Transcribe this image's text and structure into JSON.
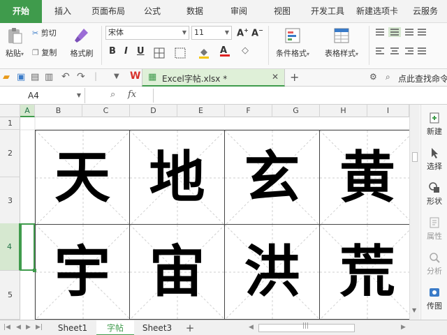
{
  "ribbon_tabs": [
    "开始",
    "插入",
    "页面布局",
    "公式",
    "数据",
    "审阅",
    "视图",
    "开发工具",
    "新建选项卡",
    "云服务"
  ],
  "active_ribbon_tab": "开始",
  "ribbon": {
    "paste_label": "粘贴",
    "cut_label": "剪切",
    "copy_label": "复制",
    "format_painter_label": "格式刷",
    "font_name": "宋体",
    "font_size": "11",
    "bold": "B",
    "italic": "I",
    "underline": "U",
    "cond_format_label": "条件格式",
    "table_style_label": "表格样式"
  },
  "qat": {
    "doc_tab_title": "Excel字帖.xlsx *",
    "search_placeholder": "点此查找命令",
    "add_tab": "+"
  },
  "formula_bar": {
    "cell_ref": "A4",
    "fx": "fx",
    "content": ""
  },
  "columns": [
    "A",
    "B",
    "C",
    "D",
    "E",
    "F",
    "G",
    "H",
    "I"
  ],
  "selected_column": "A",
  "rows": [
    "1",
    "2",
    "3",
    "4",
    "5"
  ],
  "selected_row": "4",
  "characters": [
    "天",
    "地",
    "玄",
    "黄",
    "宇",
    "宙",
    "洪",
    "荒"
  ],
  "sidebar": {
    "new": "新建",
    "select": "选择",
    "shape": "形状",
    "property": "属性",
    "analyze": "分析",
    "transfer": "传图"
  },
  "sheets": [
    "Sheet1",
    "字帖",
    "Sheet3"
  ],
  "active_sheet": "字帖",
  "add_sheet": "+",
  "colors": {
    "accent": "#3f9b4c",
    "selection": "#d6e8d0"
  }
}
